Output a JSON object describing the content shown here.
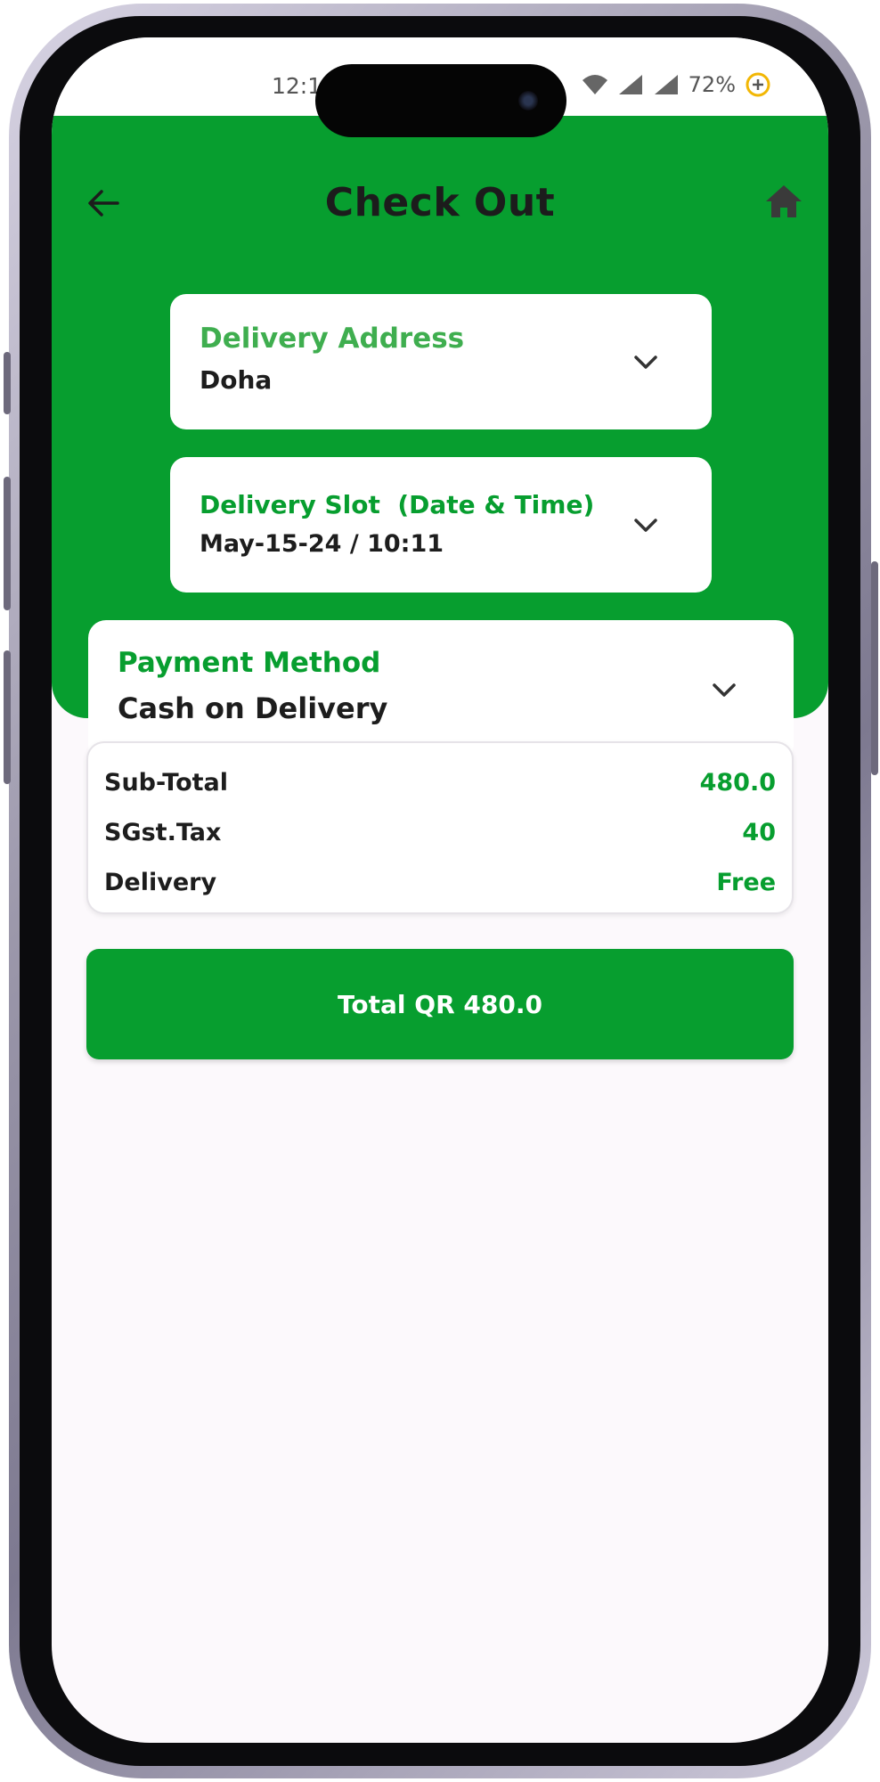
{
  "status_bar": {
    "time": "12:1",
    "battery": "72%"
  },
  "header": {
    "title": "Check Out"
  },
  "delivery_address": {
    "label": "Delivery Address",
    "value": "Doha"
  },
  "delivery_slot": {
    "label": "Delivery Slot  (Date & Time)",
    "value": "May-15-24 / 10:11"
  },
  "payment_method": {
    "label": "Payment Method",
    "value": "Cash on Delivery"
  },
  "summary": {
    "rows": [
      {
        "label": "Sub-Total",
        "value": "480.0"
      },
      {
        "label": "SGst.Tax",
        "value": "40"
      },
      {
        "label": "Delivery",
        "value": "Free"
      }
    ]
  },
  "total_button": {
    "label": "Total QR 480.0"
  },
  "colors": {
    "accent": "#079e2f",
    "address_label": "#3fae4f",
    "background": "#fcf9fc"
  }
}
